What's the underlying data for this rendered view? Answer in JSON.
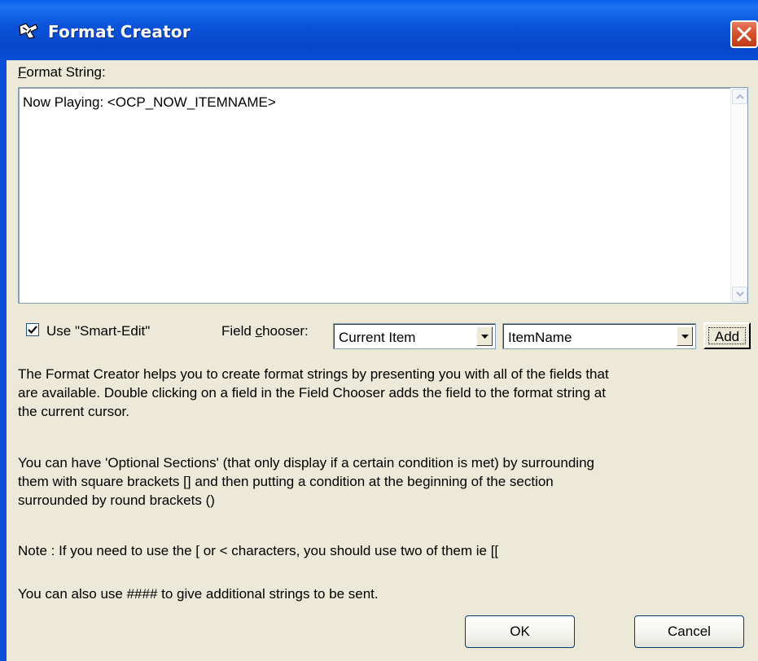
{
  "window": {
    "title": "Format Creator"
  },
  "format_string": {
    "label_prefix": "F",
    "label_rest": "ormat String:",
    "value": "Now Playing: <OCP_NOW_ITEMNAME>"
  },
  "smart_edit": {
    "label": "Use \"Smart-Edit\"",
    "checked": true
  },
  "field_chooser": {
    "label_before": "Field ",
    "label_accel": "c",
    "label_after": "hooser:",
    "category_selected": "Current Item",
    "field_selected": "ItemName",
    "add_label": "Add"
  },
  "help": {
    "p1_line1": "The Format Creator helps you to create format strings by presenting you with all of the fields that",
    "p1_line2": "are available. Double clicking on a field in the Field Chooser adds the field to the format string at",
    "p1_line3": "the current cursor.",
    "p2_line1": "You can have 'Optional Sections' (that only display if a certain condition is met) by surrounding",
    "p2_line2": "them with square brackets [] and then putting a condition at the beginning of the section",
    "p2_line3": "surrounded by round brackets ()",
    "p3": "Note : If you need to use the [ or < characters, you should use two of them ie [[",
    "p4": "You can also use #### to give additional strings to be sent."
  },
  "buttons": {
    "ok": "OK",
    "cancel": "Cancel"
  },
  "colors": {
    "titlebar": "#0a52d8",
    "close": "#d5502b",
    "dialog_bg": "#ece9d8"
  }
}
